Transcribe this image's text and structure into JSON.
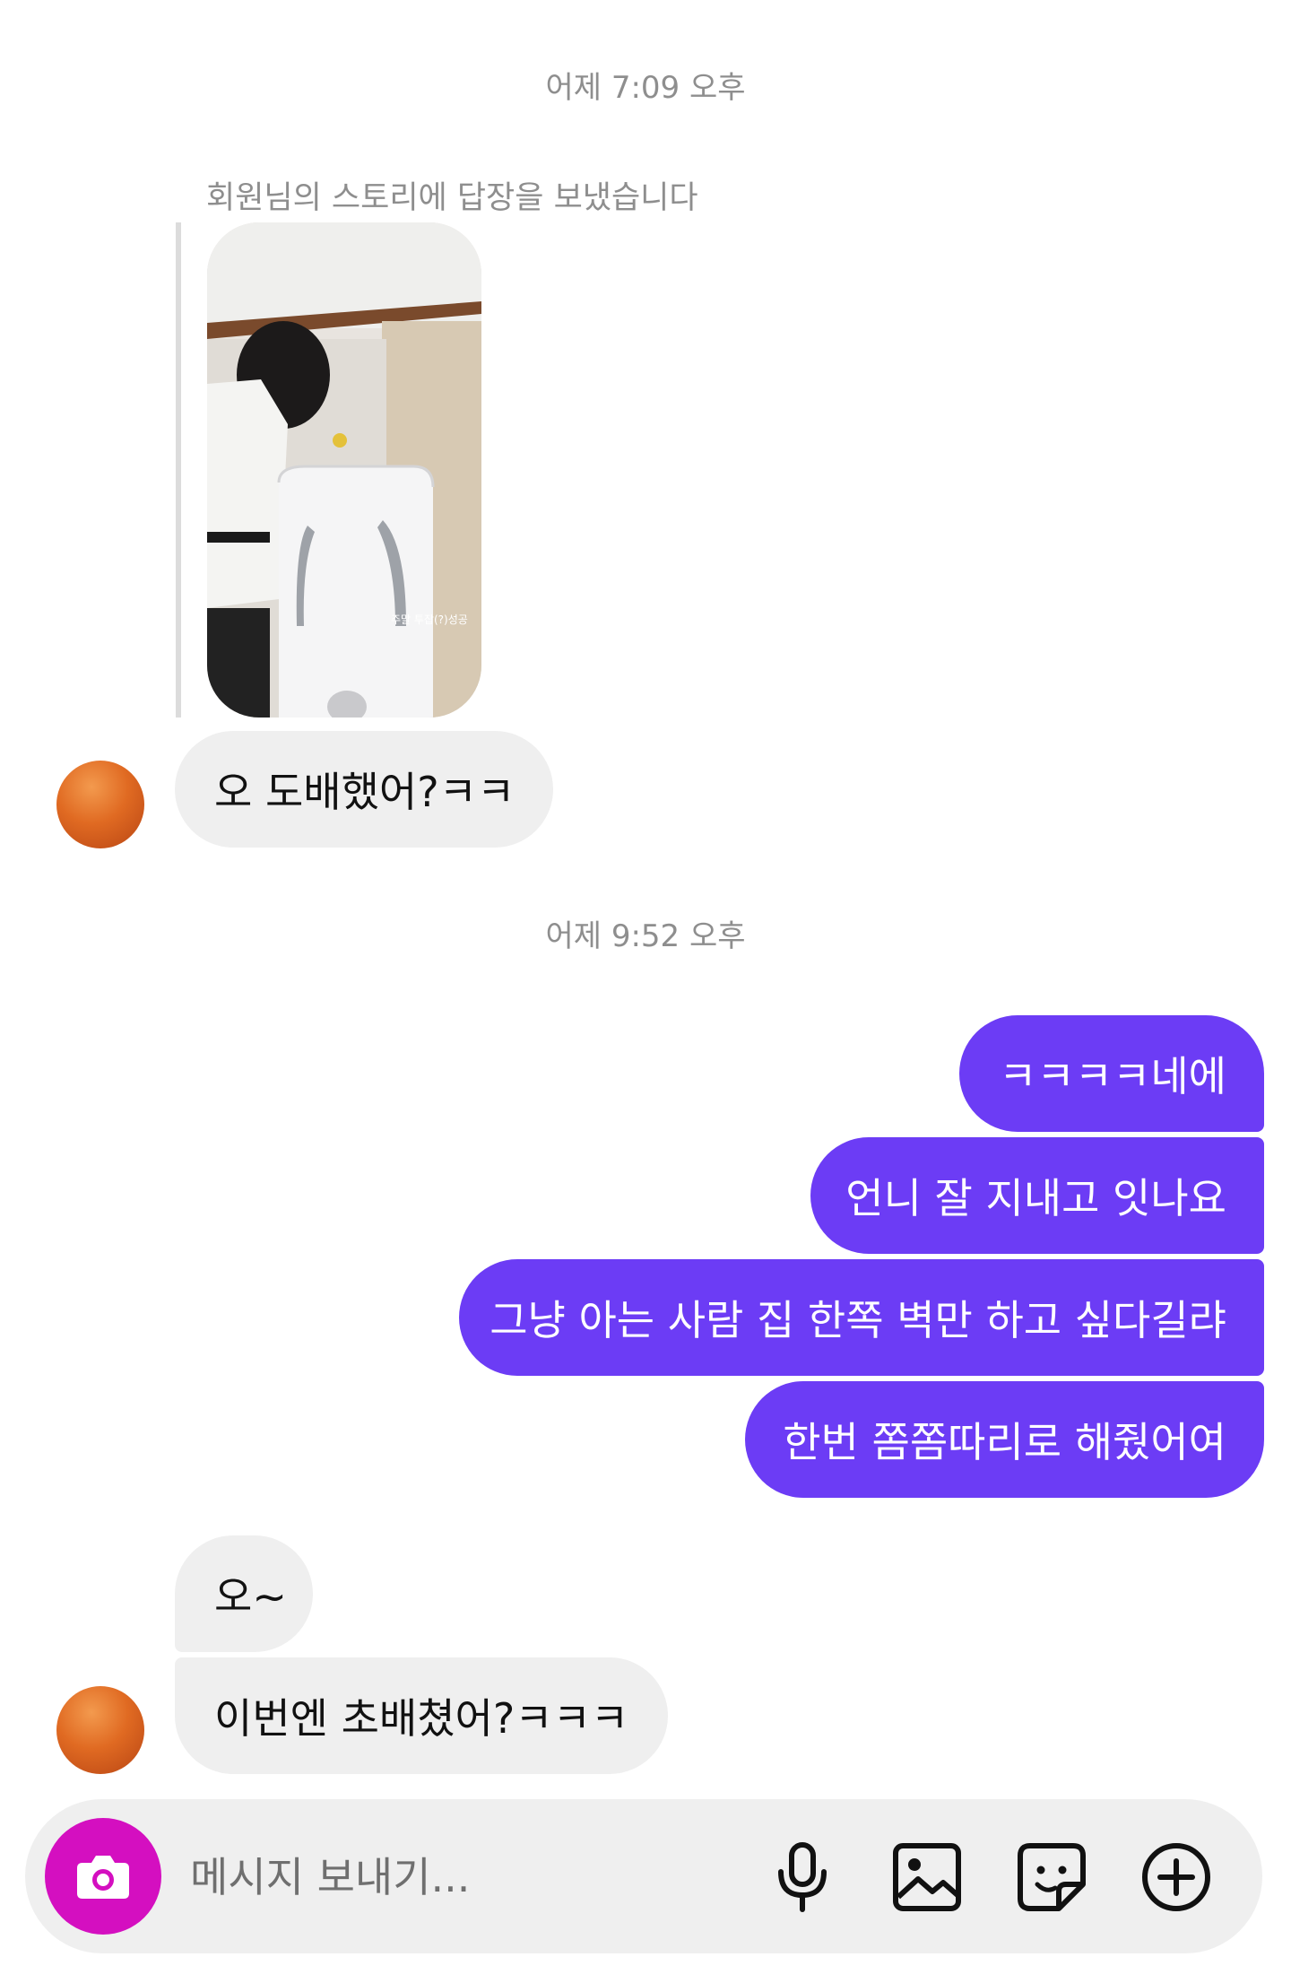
{
  "timestamps": [
    "어제 7:09 오후",
    "어제 9:52 오후"
  ],
  "story_reply": {
    "caption": "회원님의 스토리에 답장을 보냈습니다",
    "image_overlay_text": "주말 투잡(?)성공"
  },
  "messages": [
    {
      "side": "incoming",
      "text": "오 도배했어?ㅋㅋ"
    },
    {
      "side": "outgoing",
      "text": "ㅋㅋㅋㅋ네에"
    },
    {
      "side": "outgoing",
      "text": "언니 잘 지내고 잇나요"
    },
    {
      "side": "outgoing",
      "text": "그냥 아는 사람 집 한쪽 벽만 하고 싶다길랴"
    },
    {
      "side": "outgoing",
      "text": "한번 쫌쫌따리로 해줬어여"
    },
    {
      "side": "incoming",
      "text": "오~"
    },
    {
      "side": "incoming",
      "text": "이번엔 초배쳤어?ㅋㅋㅋ"
    }
  ],
  "composer": {
    "placeholder": "메시지 보내기...",
    "icons": [
      "camera-icon",
      "microphone-icon",
      "gallery-icon",
      "sticker-icon",
      "add-icon"
    ]
  },
  "colors": {
    "outgoing_bubble": "#6c3cf5",
    "incoming_bubble": "#efefef",
    "camera_button": "#d40fc0",
    "timestamp_text": "#8e8e8e"
  }
}
